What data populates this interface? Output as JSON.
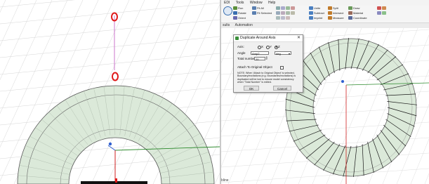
{
  "colors": {
    "ring_fill": "#dbe9d9",
    "grid_line": "#d6d6d6",
    "axis_x": "#2e8b2e",
    "axis_y": "#d02020",
    "axis_z": "#3060d0",
    "highlight": "#e01818",
    "guide_line": "#c868c8",
    "conductor": "#1a1a1a"
  },
  "menubar": {
    "items": [
      "EDI",
      "Tools",
      "Window",
      "Help"
    ]
  },
  "ribbon": {
    "run": "Run",
    "rotate": "Rotate",
    "orient": "Orient",
    "fit_all": "Fit All",
    "fit_selected": "Fit Selected",
    "draw": "Draw",
    "material": "Material",
    "layout": "Unite",
    "subtract": "Subtract",
    "imprint": "Imprint",
    "intersect": "Intersect",
    "split": "Split",
    "coordinate": "Coordinate",
    "measure": "Measure"
  },
  "tabs": {
    "results": "sults",
    "automation": "Automation"
  },
  "stub_text": "bline",
  "dialog": {
    "title": "Duplicate Around Axis",
    "axis_label": "Axis:",
    "axis_options": [
      "X",
      "Y",
      "Z"
    ],
    "axis_selected": "Z",
    "angle_label": "Angle",
    "angle_value": "Amp2",
    "angle_unit": "deg",
    "total_number_label": "Total number",
    "total_number_value": "20",
    "attach_label": "Attach To Original Object",
    "note": "NOTE: When 'Attach to Original Object' is selected, Boundary/excitations (e.g. boundaries/excitations) is duplicated will be lost to ensure model consistency when \"Total Number\" is edited.",
    "ok_label": "OK",
    "cancel_label": "Cancel"
  }
}
